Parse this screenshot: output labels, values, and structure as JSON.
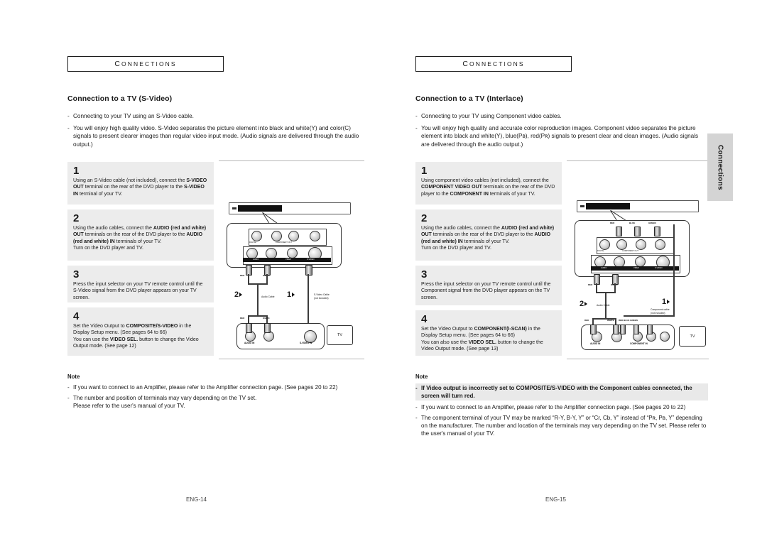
{
  "document": {
    "chapter_label": "CONNECTIONS"
  },
  "left_page": {
    "chapter": "CONNECTIONS",
    "section_title": "Connection to a TV (S-Video)",
    "intro": [
      "Connecting to your TV using an S-Video cable.",
      "You will enjoy high quality video. S-Video separates the picture element into black and white(Y) and color(C) signals to present clearer images than regular video input mode. (Audio signals are delivered through the audio output.)"
    ],
    "steps": [
      {
        "num": "1",
        "html": "Using an S-Video cable (not included), connect the <b>S-VIDEO OUT</b> terminal on the rear of the DVD player to the <b>S-VIDEO IN</b> terminal of your TV."
      },
      {
        "num": "2",
        "html": "Using the audio cables, connect the <b>AUDIO (red and white) OUT</b> terminals on the rear of the DVD player to the <b>AUDIO (red and white) IN</b> terminals of your TV.<br>Turn on the DVD player and TV."
      },
      {
        "num": "3",
        "html": "Press the input selector on your TV remote control until the S-Video signal from the DVD player appears on your TV screen."
      },
      {
        "num": "4",
        "html": "Set the Video Output to <b>COMPOSITE/S-VIDEO</b> in the Display Setup menu. (See pages 64 to 66)<br>You can use the <b>VIDEO SEL.</b> button to change the Video Output mode. (See page 12)"
      }
    ],
    "note": {
      "heading": "Note",
      "items": [
        {
          "highlight": false,
          "html": "If you want to connect to an Amplifier, please refer to the Amplifier connection page. (See pages 20 to 22)"
        },
        {
          "highlight": false,
          "html": "The number and position of terminals may vary depending on the TV set.<br>Please refer to the user's manual of your TV."
        }
      ]
    },
    "diagram": {
      "cable_labels": [
        {
          "text": "S-Video Cable",
          "sub": "(not included)"
        },
        {
          "text": "Audio Cable",
          "sub": ""
        }
      ],
      "step_markers": [
        "2",
        "1"
      ],
      "panel_labels": [
        "DIGITAL AUDIO OUT",
        "COMPONENT OUT",
        "AUDIO OUT",
        "VIDEO",
        "S-VIDEO"
      ],
      "tv_labels": [
        "AUDIO IN",
        "S-VIDEO IN"
      ],
      "wire_colors": [
        "RED",
        "WHITE"
      ],
      "tv_text": "TV"
    },
    "footer": "ENG-14"
  },
  "right_page": {
    "chapter": "CONNECTIONS",
    "section_title": "Connection to a TV (Interlace)",
    "intro": [
      "Connecting to your TV using Component video cables.",
      "You will enjoy high quality and accurate color reproduction images. Component video separates the picture element into black and white(Y), blue(Pʙ), red(Pʀ) signals to present clear and clean images. (Audio signals are delivered through the audio output.)"
    ],
    "steps": [
      {
        "num": "1",
        "html": "Using component video cables (not included), connect the <b>COMPONENT VIDEO OUT</b> terminals on the rear of the DVD player to the <b>COMPONENT IN</b> terminals of your TV."
      },
      {
        "num": "2",
        "html": "Using the audio cables, connect the <b>AUDIO (red and white) OUT</b> terminals on the rear of the DVD player to the <b>AUDIO (red and white) IN</b> terminals of your TV.<br>Turn on the DVD player and TV."
      },
      {
        "num": "3",
        "html": "Press the input selector on your TV remote control until the Component signal from the DVD player appears on the TV screen."
      },
      {
        "num": "4",
        "html": "Set the Video Output to <b>COMPONENT(I-SCAN)</b> in the Display Setup menu. (See pages 64 to 66)<br>You can also use the <b>VIDEO SEL.</b> button to change the Video Output mode. (See page 13)"
      }
    ],
    "note": {
      "heading": "Note",
      "items": [
        {
          "highlight": true,
          "html": "If Video output is incorrectly set to COMPOSITE/S-VIDEO with the Component cables connected, the screen will turn red."
        },
        {
          "highlight": false,
          "html": "If you want to connect to an Amplifier, please refer to the Amplifier connection page. (See pages 20 to 22)"
        },
        {
          "highlight": false,
          "html": "The component terminal of your TV may be marked “R-Y, B-Y, Y” or “Cr, Cb, Y” instead of “Pʀ, Pʙ, Y” depending on the manufacturer. The number and location of the terminals may vary depending on the TV set. Please refer to the user's manual of your TV."
        }
      ]
    },
    "diagram": {
      "cable_labels": [
        {
          "text": "Component cable",
          "sub": "(not included)"
        },
        {
          "text": "Audio Cable",
          "sub": ""
        }
      ],
      "step_markers": [
        "2",
        "1"
      ],
      "panel_labels": [
        "DIGITAL AUDIO OUT",
        "COMPONENT OUT",
        "AUDIO OUT",
        "VIDEO",
        "S-VIDEO"
      ],
      "component_colors": [
        "RED",
        "BLUE",
        "GREEN"
      ],
      "tv_labels": [
        "AUDIO IN",
        "COMPONENT IN"
      ],
      "wire_colors": [
        "RED",
        "WHITE"
      ],
      "tv_text": "TV"
    },
    "footer": "ENG-15"
  },
  "side_tab": {
    "label": "Connections"
  }
}
